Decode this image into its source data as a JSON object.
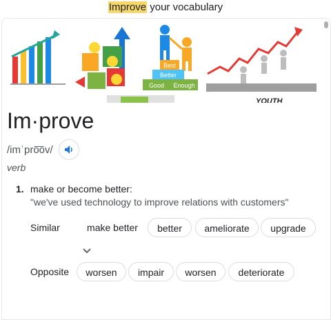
{
  "header": {
    "highlight": "Improve",
    "rest": " your vocabulary"
  },
  "images": [
    "growth-chart-image",
    "teamwork-puzzle-image",
    "best-better-good-image",
    "rising-graph-image",
    "money-image",
    "youth-image"
  ],
  "entry": {
    "word": "Im·prove",
    "phonetic": "/imˈpro͞ov/",
    "part_of_speech": "verb",
    "sense_number": "1.",
    "definition": "make or become better:",
    "example": "\"we've used technology to improve relations with customers\""
  },
  "similar": {
    "label": "Similar",
    "items": [
      "make better",
      "better",
      "ameliorate",
      "upgrade"
    ]
  },
  "opposite": {
    "label": "Opposite",
    "items": [
      "worsen",
      "impair",
      "worsen",
      "deteriorate"
    ]
  },
  "image_text": {
    "best": "Best",
    "better": "Better",
    "good": "Good",
    "enough": "Enough",
    "youth": "YOUTH"
  },
  "colors": {
    "highlight": "#f6d86a",
    "speaker_blue": "#1a73e8"
  }
}
